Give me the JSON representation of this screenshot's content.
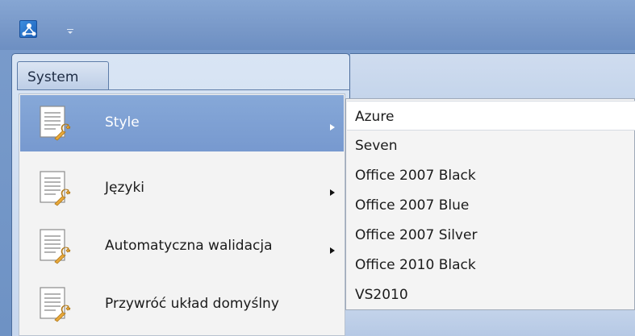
{
  "ribbon": {
    "tab_label": "System"
  },
  "menu": {
    "items": [
      {
        "label": "Style",
        "selected": true,
        "has_submenu": true
      },
      {
        "label": "Języki",
        "selected": false,
        "has_submenu": true
      },
      {
        "label": "Automatyczna walidacja",
        "selected": false,
        "has_submenu": true
      },
      {
        "label": "Przywróć układ domyślny",
        "selected": false,
        "has_submenu": false
      }
    ]
  },
  "submenu": {
    "items": [
      {
        "label": "Azure"
      },
      {
        "label": "Seven"
      },
      {
        "label": "Office 2007 Black"
      },
      {
        "label": "Office 2007 Blue"
      },
      {
        "label": "Office 2007 Silver"
      },
      {
        "label": "Office 2010 Black"
      },
      {
        "label": "VS2010"
      }
    ]
  },
  "colors": {
    "accent": "#7799cf",
    "titlebar": "#7898c8",
    "menu_bg": "#f3f3f3"
  },
  "icons": {
    "app": "app-logo-icon",
    "menu_item": "document-wrench-icon",
    "submenu_arrow": "triangle-right-icon"
  }
}
